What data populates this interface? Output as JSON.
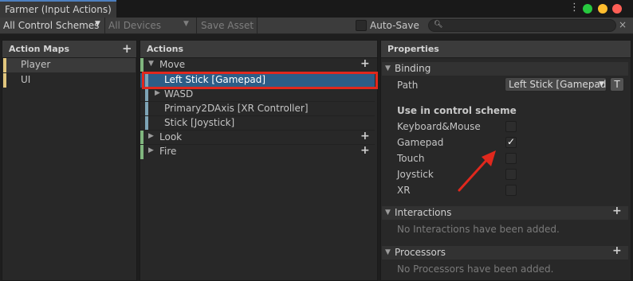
{
  "window": {
    "tab_title": "Farmer (Input Actions)",
    "menu_icon": "kebab-menu-icon",
    "colors": {
      "close": "#ff5f56",
      "minimize": "#ffbd2e",
      "maximize": "#27c93f"
    }
  },
  "toolbar": {
    "control_schemes": "All Control Schemes",
    "devices": "All Devices",
    "save_asset": "Save Asset",
    "auto_save": "Auto-Save",
    "search_value": "",
    "search_icon": "search-icon",
    "clear_glyph": "×"
  },
  "action_maps": {
    "title": "Action Maps",
    "add_glyph": "+",
    "items": [
      {
        "label": "Player",
        "selected": true
      },
      {
        "label": "UI",
        "selected": false
      }
    ]
  },
  "actions": {
    "title": "Actions",
    "rows": [
      {
        "label": "Move",
        "kind": "action",
        "expanded": true
      },
      {
        "label": "Left Stick [Gamepad]",
        "kind": "binding",
        "selected": true
      },
      {
        "label": "WASD",
        "kind": "composite"
      },
      {
        "label": "Primary2DAxis [XR Controller]",
        "kind": "binding"
      },
      {
        "label": "Stick [Joystick]",
        "kind": "binding"
      },
      {
        "label": "Look",
        "kind": "action",
        "expanded": false
      },
      {
        "label": "Fire",
        "kind": "action",
        "expanded": false
      }
    ],
    "colors": {
      "action_stripe": "#80b67e",
      "binding_stripe": "#7ea4b6",
      "selection": "#2c5d87",
      "callout": "#e0281d"
    }
  },
  "properties": {
    "title": "Properties",
    "binding_section": "Binding",
    "path_label": "Path",
    "path_value": "Left Stick [Gamepad]",
    "t_button": "T",
    "use_in_scheme": "Use in control scheme",
    "schemes": [
      {
        "label": "Keyboard&Mouse",
        "checked": false
      },
      {
        "label": "Gamepad",
        "checked": true
      },
      {
        "label": "Touch",
        "checked": false
      },
      {
        "label": "Joystick",
        "checked": false
      },
      {
        "label": "XR",
        "checked": false
      }
    ],
    "interactions_section": "Interactions",
    "interactions_empty": "No Interactions have been added.",
    "processors_section": "Processors",
    "processors_empty": "No Processors have been added."
  }
}
